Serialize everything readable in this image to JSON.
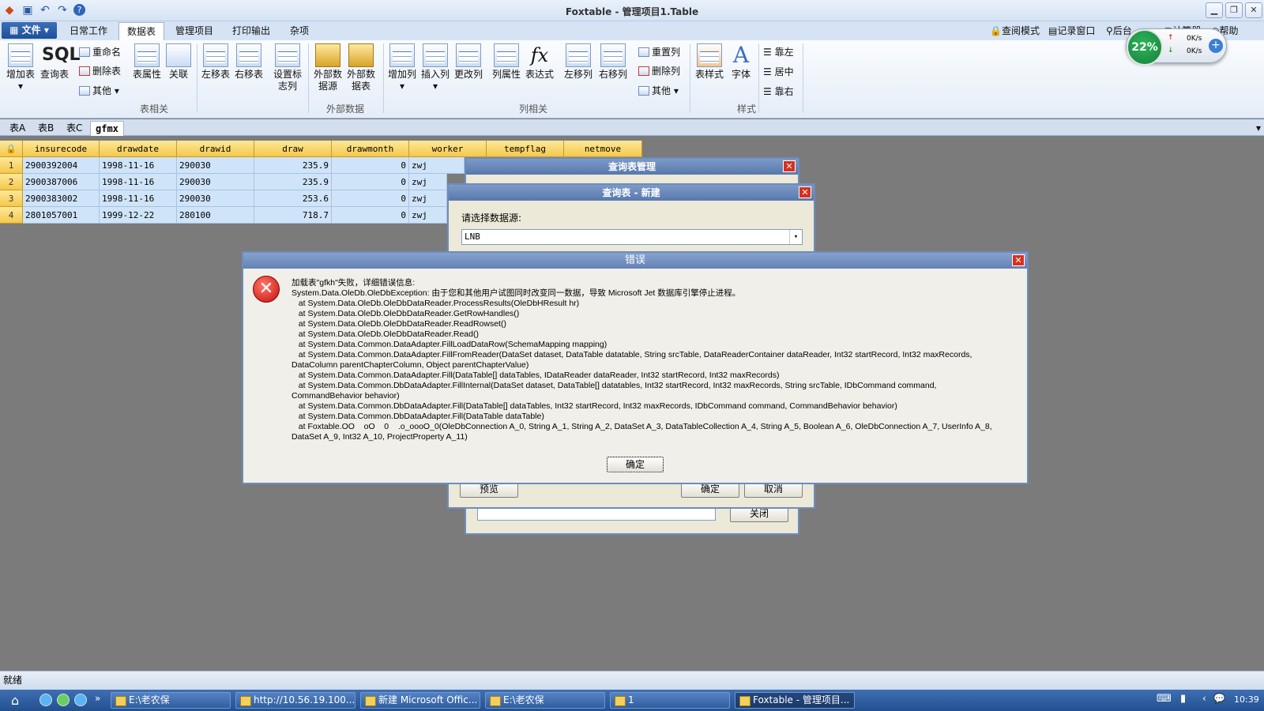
{
  "window": {
    "title": "Foxtable - 管理项目1.Table"
  },
  "menu": {
    "file_label": "文件",
    "tabs": [
      "日常工作",
      "数据表",
      "管理项目",
      "打印输出",
      "杂项"
    ],
    "right_tools": [
      "查阅模式",
      "记录窗口",
      "后台",
      "计算器",
      "帮助"
    ]
  },
  "ribbon": {
    "buttons": [
      "增加表",
      "查询表",
      "重命名",
      "删除表",
      "其他",
      "表属性",
      "关联",
      "左移表",
      "右移表",
      "设置标志列",
      "外部数据源",
      "外部数据表",
      "增加列",
      "插入列",
      "更改列",
      "列属性",
      "表达式",
      "左移列",
      "右移列",
      "重置列",
      "删除列",
      "其他",
      "表样式",
      "字体",
      "靠左",
      "居中",
      "靠右"
    ],
    "sql_label": "SQL",
    "groups": [
      "表相关",
      "外部数据",
      "列相关",
      "样式"
    ]
  },
  "network_widget": {
    "percent": "22%",
    "up": "0K/s",
    "down": "0K/s"
  },
  "doc_tabs": [
    "表A",
    "表B",
    "表C",
    "gfmx"
  ],
  "table": {
    "columns": [
      "insurecode",
      "drawdate",
      "drawid",
      "draw",
      "drawmonth",
      "worker",
      "tempflag",
      "netmove"
    ],
    "rows": [
      [
        "1",
        "2900392004",
        "1998-11-16",
        "290030",
        "235.9",
        "0",
        "zwj"
      ],
      [
        "2",
        "2900387006",
        "1998-11-16",
        "290030",
        "235.9",
        "0",
        "zwj"
      ],
      [
        "3",
        "2900383002",
        "1998-11-16",
        "290030",
        "253.6",
        "0",
        "zwj"
      ],
      [
        "4",
        "2801057001",
        "1999-12-22",
        "280100",
        "718.7",
        "0",
        "zwj"
      ]
    ]
  },
  "dialog_query_mgr": {
    "title": "查询表管理",
    "close_label": "关闭"
  },
  "dialog_new_query": {
    "title": "查询表 - 新建",
    "datasource_label": "请选择数据源:",
    "datasource_value": "LNB",
    "preview_label": "预览",
    "ok_label": "确定",
    "cancel_label": "取消"
  },
  "error_dialog": {
    "title": "错误",
    "message": "加载表\"gfkh\"失败，详细错误信息:\nSystem.Data.OleDb.OleDbException: 由于您和其他用户试图同时改变同一数据，导致 Microsoft Jet 数据库引擎停止进程。\n   at System.Data.OleDb.OleDbDataReader.ProcessResults(OleDbHResult hr)\n   at System.Data.OleDb.OleDbDataReader.GetRowHandles()\n   at System.Data.OleDb.OleDbDataReader.ReadRowset()\n   at System.Data.OleDb.OleDbDataReader.Read()\n   at System.Data.Common.DataAdapter.FillLoadDataRow(SchemaMapping mapping)\n   at System.Data.Common.DataAdapter.FillFromReader(DataSet dataset, DataTable datatable, String srcTable, DataReaderContainer dataReader, Int32 startRecord, Int32 maxRecords,\nDataColumn parentChapterColumn, Object parentChapterValue)\n   at System.Data.Common.DataAdapter.Fill(DataTable[] dataTables, IDataReader dataReader, Int32 startRecord, Int32 maxRecords)\n   at System.Data.Common.DbDataAdapter.FillInternal(DataSet dataset, DataTable[] datatables, Int32 startRecord, Int32 maxRecords, String srcTable, IDbCommand command,\nCommandBehavior behavior)\n   at System.Data.Common.DbDataAdapter.Fill(DataTable[] dataTables, Int32 startRecord, Int32 maxRecords, IDbCommand command, CommandBehavior behavior)\n   at System.Data.Common.DbDataAdapter.Fill(DataTable dataTable)\n   at Foxtable.OO    oO    0    .o_oooO_0(OleDbConnection A_0, String A_1, String A_2, DataSet A_3, DataTableCollection A_4, String A_5, Boolean A_6, OleDbConnection A_7, UserInfo A_8,\nDataSet A_9, Int32 A_10, ProjectProperty A_11)",
    "ok_label": "确定"
  },
  "status": {
    "text": "就绪"
  },
  "taskbar": {
    "items": [
      "E:\\老农保",
      "http://10.56.19.100...",
      "新建 Microsoft Offic...",
      "E:\\老农保",
      "1",
      "Foxtable - 管理项目..."
    ],
    "clock": "10:39"
  }
}
